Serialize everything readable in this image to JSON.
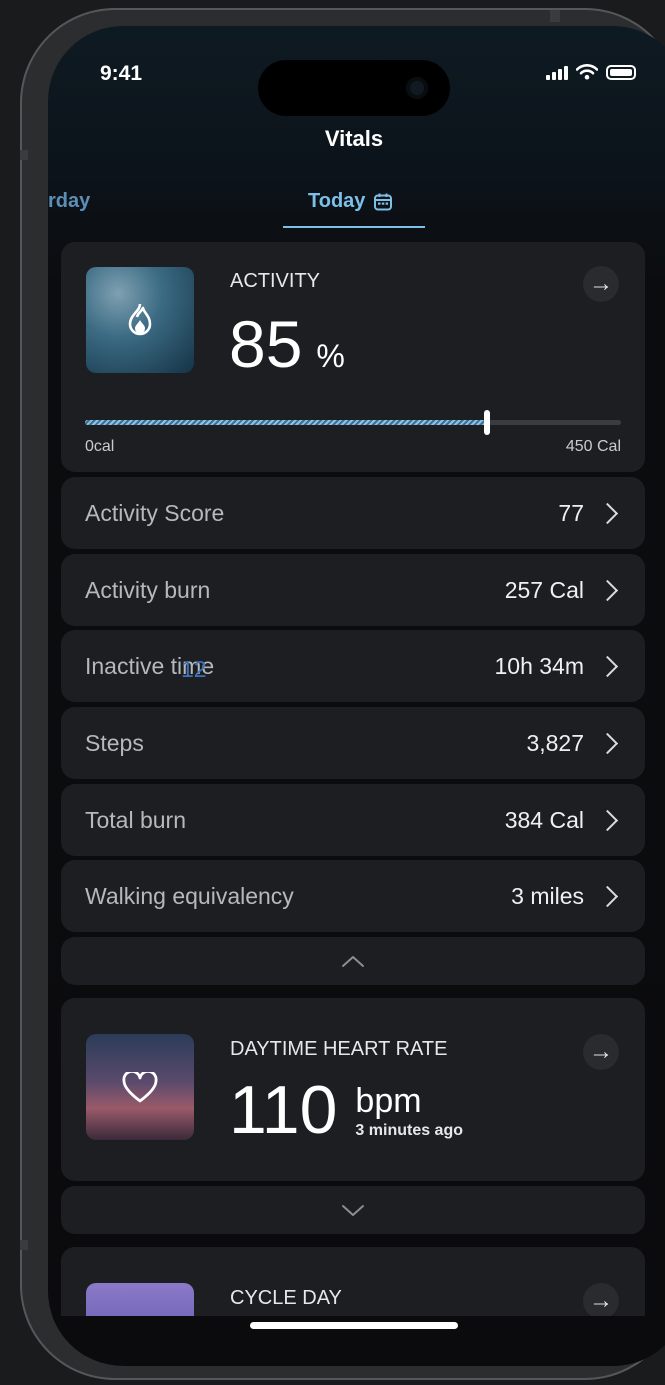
{
  "status": {
    "time": "9:41"
  },
  "header": {
    "title": "Vitals"
  },
  "tabs": {
    "previous": "rday",
    "current": "Today"
  },
  "activity": {
    "heading": "ACTIVITY",
    "value": "85",
    "unit": "%",
    "progress": 0.75,
    "min_label": "0cal",
    "max_label": "450 Cal"
  },
  "metrics": [
    {
      "label": "Activity Score",
      "value": "77"
    },
    {
      "label": "Activity burn",
      "value": "257 Cal"
    },
    {
      "label": "Inactive time",
      "value": "10h 34m"
    },
    {
      "label": "Steps",
      "value": "3,827"
    },
    {
      "label": "Total burn",
      "value": "384 Cal"
    },
    {
      "label": "Walking equivalency",
      "value": "3 miles"
    }
  ],
  "overlay_text": "12",
  "heart_rate": {
    "heading": "DAYTIME HEART RATE",
    "value": "110",
    "unit": "bpm",
    "time_ago": "3 minutes ago"
  },
  "cycle": {
    "heading": "CYCLE DAY"
  },
  "colors": {
    "accent": "#7ebfe8",
    "card": "#1d1e21",
    "background": "#0b0b0d"
  }
}
